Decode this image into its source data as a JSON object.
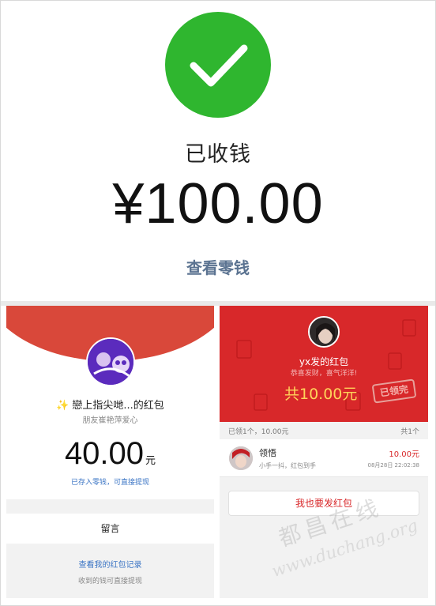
{
  "top": {
    "status_label": "已收钱",
    "amount": "¥100.00",
    "view_change_link": "查看零钱",
    "check_color": "#2fb62f"
  },
  "left": {
    "sender_title": "戀上指尖哋...的红包",
    "sender_subtitle": "朋友崔艳萍爱心",
    "amount": "40.00",
    "unit": "元",
    "saved_note": "已存入零钱，可直接提现",
    "message_button": "留言",
    "records_link": "查看我的红包记录",
    "records_note": "收到的钱可直接提现",
    "red_color": "#d9483a",
    "icons": {
      "sparkle": "sparkle-icon",
      "avatar": "avatar"
    }
  },
  "right": {
    "title": "yx发的红包",
    "subtitle": "恭喜发财，喜气洋洋!",
    "total_amount": "共10.00元",
    "stamp": "已领完",
    "summary_left": "已领1个，10.00元",
    "summary_right": "共1个",
    "receiver": {
      "name": "领悟",
      "message": "小手一抖，红包到手",
      "amount": "10.00元",
      "time": "08月28日 22:02:38"
    },
    "send_button": "我也要发红包",
    "red_color": "#d8282a",
    "accent_yellow": "#ffd35a"
  },
  "watermark": {
    "line1": "都昌在线",
    "line2": "www.duchang.org"
  }
}
